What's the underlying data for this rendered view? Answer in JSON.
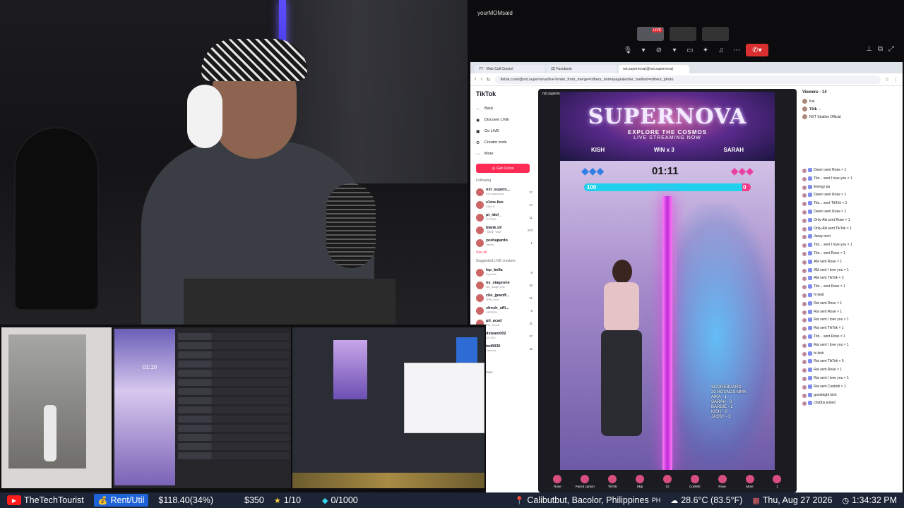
{
  "call": {
    "caller": "yourMOMsaid",
    "live_tag": "LIVE"
  },
  "browser": {
    "tabs": [
      "YT · Web Call Control",
      "(3) Facebook",
      "nxt.supernova(@nxt.supernova)"
    ],
    "url": "tiktok.com/@nxt.supernova/live?enter_from_merge=others_homepage&enter_method=others_photo"
  },
  "tiktok": {
    "logo": "TikTok",
    "back": "Back",
    "nav": [
      "Discover LIVE",
      "Go LIVE",
      "Creator tools",
      "More"
    ],
    "get_coins": "Get Coins",
    "following_label": "Following",
    "following": [
      {
        "name": "nxt_supern...",
        "sub": "nxt.supernova",
        "count": "17"
      },
      {
        "name": "s1ms.live",
        "sub": "S1M-S",
        "count": "17"
      },
      {
        "name": "pt_idol_",
        "sub": "PT IDOL",
        "count": "11"
      },
      {
        "name": "blank.s9",
        "sub": "【B9】YAM",
        "count": "470"
      },
      {
        "name": "yeshapardo",
        "sub": "Yesha",
        "count": "1"
      }
    ],
    "see_all": "See all",
    "suggested_label": "Suggested LIVE creators",
    "suggested": [
      {
        "name": "lvp_bella",
        "sub": "lvp.bella",
        "count": "8"
      },
      {
        "name": "ns_stageone",
        "sub": "NS_Stage One",
        "count": "16"
      },
      {
        "name": "clio_jpwoff...",
        "sub": "JPW-CLIO",
        "count": "11"
      },
      {
        "name": "vfresh_offi...",
        "sub": "VFRESH",
        "count": "9"
      },
      {
        "name": "pti_acad",
        "sub": "PTI_ACAD",
        "count": "11"
      },
      {
        "name": "dxteam002",
        "sub": "DX-002",
        "count": "17"
      },
      {
        "name": "ted0036",
        "sub": "Xamora",
        "count": "11"
      }
    ],
    "footer_links": [
      "pany",
      "ram",
      "s & Policies",
      "TikTok"
    ]
  },
  "stream": {
    "host": "nxt.supernova",
    "banner_title": "SUPERNOVA",
    "banner_sub": "EXPLORE THE COSMOS",
    "banner_sub2": "LIVE STREAMING NOW",
    "left_player": "KISH",
    "mid": "WIN x 3",
    "right_player": "SARAH",
    "timer": "01:11",
    "left_score": "100",
    "right_score": "0",
    "progress_fraction": 0.95,
    "scoreboard": [
      "SCOREBOARD",
      "20 ROUNDS MMX",
      "AIKA - 1",
      "SARAH - 0",
      "BARBIE - 2",
      "KISH - 0",
      "JASSY - 3"
    ],
    "gifts": [
      "Rose",
      "Pancit canton",
      "TikTok",
      "Skip",
      "10",
      "Confetti",
      "Rose",
      "More",
      "1"
    ]
  },
  "chat": {
    "viewers_label": "Viewers",
    "viewers_count": "14",
    "viewers": [
      "Kai",
      "𝗧𝗶𝘁𝗸 ...",
      "NXT Studios Official"
    ],
    "messages": [
      "Daren sent Rose × 1",
      "Tito... sent I love you × 1",
      "Energy pa",
      "Daren sent Rose × 1",
      "Tito... sent TikTok × 1",
      "Daren sent Rose × 1",
      "Only-Aki sent Rose × 1",
      "Only-Aki sent TikTok × 1",
      "Jassy next",
      "Tito... sent I love you × 1",
      "Tito... sent Rose × 1",
      "AM sent Rose × 1",
      "AM sent I love you × 1",
      "AM sent TikTok × 2",
      "Tito... sent Rose × 1",
      "hi kedi",
      "Rai sent Rose × 1",
      "Rai sent Rose × 1",
      "Rai sent I love you × 1",
      "Rai sent TikTok × 1",
      "Tito... sent Rose × 1",
      "Rai sent I love you × 1",
      "hi kish",
      "Rai sent TikTok × 5",
      "Rai sent Rose × 1",
      "Rai sent I love you × 1",
      "Rai sent Confetti × 1",
      "goodnight kish",
      "chubbs joined"
    ]
  },
  "strip": {
    "timer": "01:10"
  },
  "ticker": {
    "channel": "TheTechTourist",
    "rent": "Rent/Util",
    "rent_value": "$118.40(34%)",
    "amount": "$350",
    "star": "1/10",
    "diamond": "0/1000",
    "location": "Calibutbut, Bacolor, Philippines",
    "location_tag": "PH",
    "weather": "28.6°C (83.5°F)",
    "date": "Thu, Aug 27 2026",
    "time": "1:34:32 PM"
  }
}
